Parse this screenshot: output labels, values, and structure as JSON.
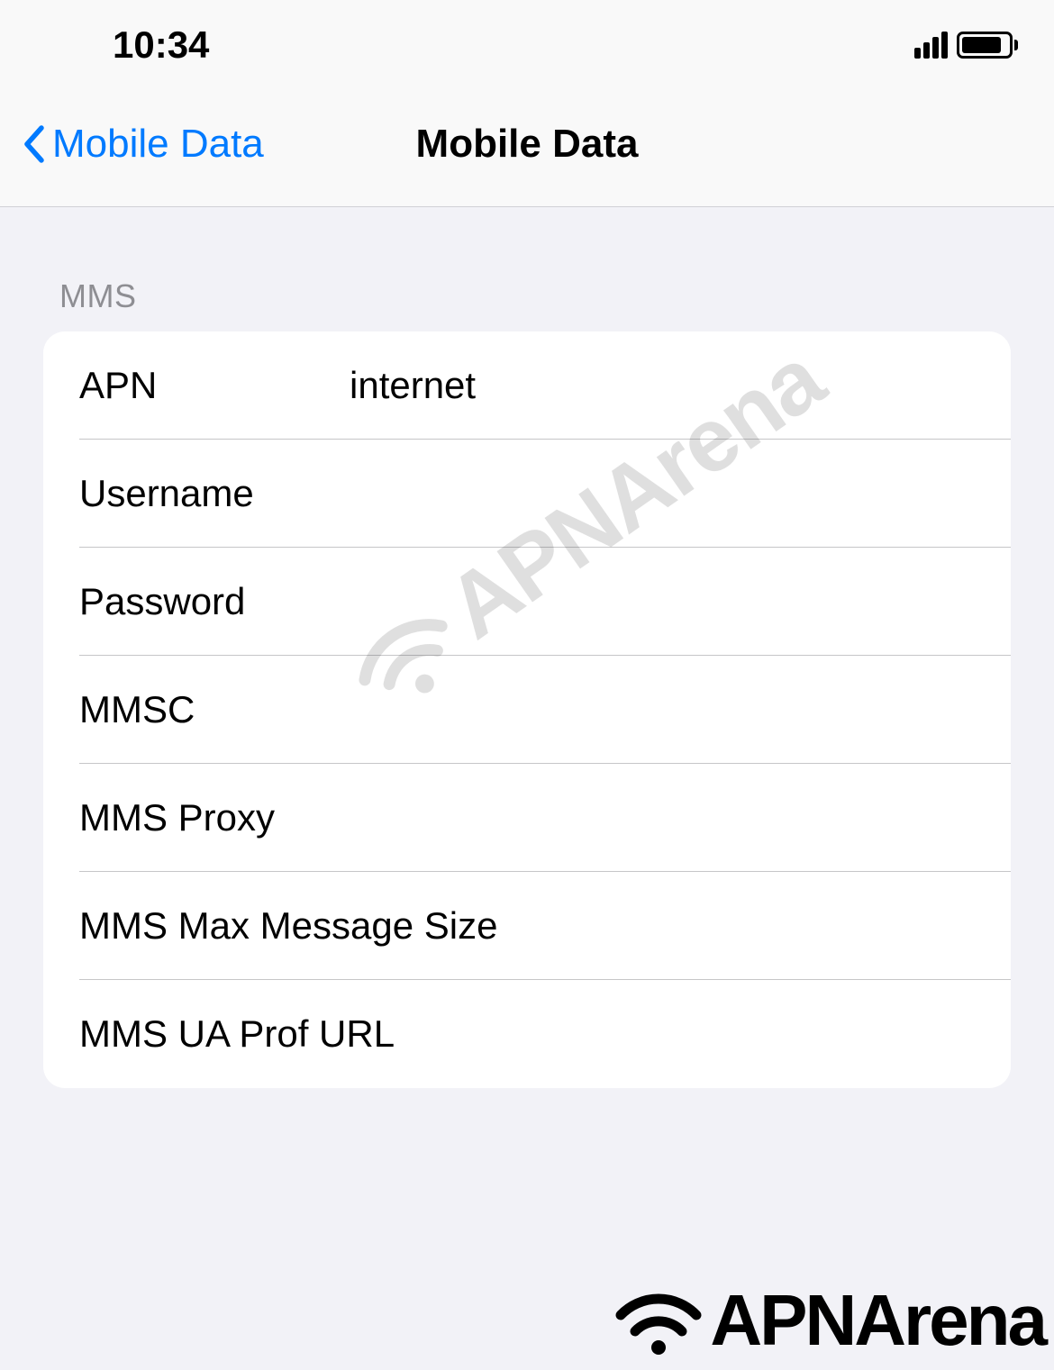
{
  "statusBar": {
    "time": "10:34"
  },
  "navBar": {
    "backLabel": "Mobile Data",
    "title": "Mobile Data"
  },
  "section": {
    "header": "MMS",
    "rows": {
      "apn": {
        "label": "APN",
        "value": "internet"
      },
      "username": {
        "label": "Username",
        "value": ""
      },
      "password": {
        "label": "Password",
        "value": ""
      },
      "mmsc": {
        "label": "MMSC",
        "value": ""
      },
      "mmsProxy": {
        "label": "MMS Proxy",
        "value": ""
      },
      "mmsMaxSize": {
        "label": "MMS Max Message Size",
        "value": ""
      },
      "mmsUaProf": {
        "label": "MMS UA Prof URL",
        "value": ""
      }
    }
  },
  "watermark": {
    "text": "APNArena"
  },
  "logo": {
    "text": "APNArena"
  }
}
